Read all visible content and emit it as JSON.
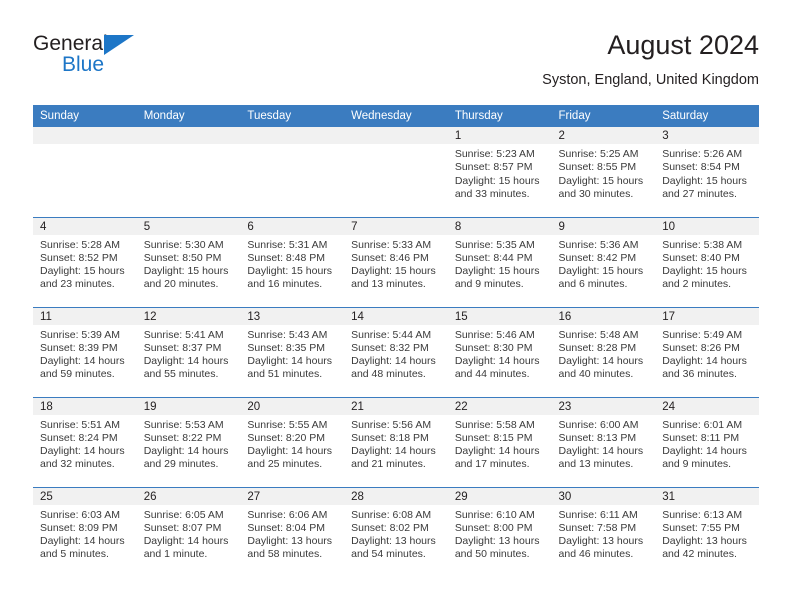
{
  "brand": {
    "name_dark": "General",
    "name_blue": "Blue",
    "accent_color": "#1d76c7"
  },
  "header": {
    "title": "August 2024",
    "location": "Syston, England, United Kingdom",
    "header_bg": "#3b7cc0",
    "daynum_bg": "#f1f1f1"
  },
  "weekday_headers": [
    "Sunday",
    "Monday",
    "Tuesday",
    "Wednesday",
    "Thursday",
    "Friday",
    "Saturday"
  ],
  "labels": {
    "sunrise_prefix": "Sunrise:",
    "sunset_prefix": "Sunset:",
    "daylight_prefix": "Daylight:"
  },
  "weeks": [
    [
      {
        "day": "",
        "sunrise": "",
        "sunset": "",
        "daylight_line1": "",
        "daylight_line2": "",
        "empty": true
      },
      {
        "day": "",
        "sunrise": "",
        "sunset": "",
        "daylight_line1": "",
        "daylight_line2": "",
        "empty": true
      },
      {
        "day": "",
        "sunrise": "",
        "sunset": "",
        "daylight_line1": "",
        "daylight_line2": "",
        "empty": true
      },
      {
        "day": "",
        "sunrise": "",
        "sunset": "",
        "daylight_line1": "",
        "daylight_line2": "",
        "empty": true
      },
      {
        "day": "1",
        "sunrise": "Sunrise: 5:23 AM",
        "sunset": "Sunset: 8:57 PM",
        "daylight_line1": "Daylight: 15 hours",
        "daylight_line2": "and 33 minutes.",
        "empty": false
      },
      {
        "day": "2",
        "sunrise": "Sunrise: 5:25 AM",
        "sunset": "Sunset: 8:55 PM",
        "daylight_line1": "Daylight: 15 hours",
        "daylight_line2": "and 30 minutes.",
        "empty": false
      },
      {
        "day": "3",
        "sunrise": "Sunrise: 5:26 AM",
        "sunset": "Sunset: 8:54 PM",
        "daylight_line1": "Daylight: 15 hours",
        "daylight_line2": "and 27 minutes.",
        "empty": false
      }
    ],
    [
      {
        "day": "4",
        "sunrise": "Sunrise: 5:28 AM",
        "sunset": "Sunset: 8:52 PM",
        "daylight_line1": "Daylight: 15 hours",
        "daylight_line2": "and 23 minutes.",
        "empty": false
      },
      {
        "day": "5",
        "sunrise": "Sunrise: 5:30 AM",
        "sunset": "Sunset: 8:50 PM",
        "daylight_line1": "Daylight: 15 hours",
        "daylight_line2": "and 20 minutes.",
        "empty": false
      },
      {
        "day": "6",
        "sunrise": "Sunrise: 5:31 AM",
        "sunset": "Sunset: 8:48 PM",
        "daylight_line1": "Daylight: 15 hours",
        "daylight_line2": "and 16 minutes.",
        "empty": false
      },
      {
        "day": "7",
        "sunrise": "Sunrise: 5:33 AM",
        "sunset": "Sunset: 8:46 PM",
        "daylight_line1": "Daylight: 15 hours",
        "daylight_line2": "and 13 minutes.",
        "empty": false
      },
      {
        "day": "8",
        "sunrise": "Sunrise: 5:35 AM",
        "sunset": "Sunset: 8:44 PM",
        "daylight_line1": "Daylight: 15 hours",
        "daylight_line2": "and 9 minutes.",
        "empty": false
      },
      {
        "day": "9",
        "sunrise": "Sunrise: 5:36 AM",
        "sunset": "Sunset: 8:42 PM",
        "daylight_line1": "Daylight: 15 hours",
        "daylight_line2": "and 6 minutes.",
        "empty": false
      },
      {
        "day": "10",
        "sunrise": "Sunrise: 5:38 AM",
        "sunset": "Sunset: 8:40 PM",
        "daylight_line1": "Daylight: 15 hours",
        "daylight_line2": "and 2 minutes.",
        "empty": false
      }
    ],
    [
      {
        "day": "11",
        "sunrise": "Sunrise: 5:39 AM",
        "sunset": "Sunset: 8:39 PM",
        "daylight_line1": "Daylight: 14 hours",
        "daylight_line2": "and 59 minutes.",
        "empty": false
      },
      {
        "day": "12",
        "sunrise": "Sunrise: 5:41 AM",
        "sunset": "Sunset: 8:37 PM",
        "daylight_line1": "Daylight: 14 hours",
        "daylight_line2": "and 55 minutes.",
        "empty": false
      },
      {
        "day": "13",
        "sunrise": "Sunrise: 5:43 AM",
        "sunset": "Sunset: 8:35 PM",
        "daylight_line1": "Daylight: 14 hours",
        "daylight_line2": "and 51 minutes.",
        "empty": false
      },
      {
        "day": "14",
        "sunrise": "Sunrise: 5:44 AM",
        "sunset": "Sunset: 8:32 PM",
        "daylight_line1": "Daylight: 14 hours",
        "daylight_line2": "and 48 minutes.",
        "empty": false
      },
      {
        "day": "15",
        "sunrise": "Sunrise: 5:46 AM",
        "sunset": "Sunset: 8:30 PM",
        "daylight_line1": "Daylight: 14 hours",
        "daylight_line2": "and 44 minutes.",
        "empty": false
      },
      {
        "day": "16",
        "sunrise": "Sunrise: 5:48 AM",
        "sunset": "Sunset: 8:28 PM",
        "daylight_line1": "Daylight: 14 hours",
        "daylight_line2": "and 40 minutes.",
        "empty": false
      },
      {
        "day": "17",
        "sunrise": "Sunrise: 5:49 AM",
        "sunset": "Sunset: 8:26 PM",
        "daylight_line1": "Daylight: 14 hours",
        "daylight_line2": "and 36 minutes.",
        "empty": false
      }
    ],
    [
      {
        "day": "18",
        "sunrise": "Sunrise: 5:51 AM",
        "sunset": "Sunset: 8:24 PM",
        "daylight_line1": "Daylight: 14 hours",
        "daylight_line2": "and 32 minutes.",
        "empty": false
      },
      {
        "day": "19",
        "sunrise": "Sunrise: 5:53 AM",
        "sunset": "Sunset: 8:22 PM",
        "daylight_line1": "Daylight: 14 hours",
        "daylight_line2": "and 29 minutes.",
        "empty": false
      },
      {
        "day": "20",
        "sunrise": "Sunrise: 5:55 AM",
        "sunset": "Sunset: 8:20 PM",
        "daylight_line1": "Daylight: 14 hours",
        "daylight_line2": "and 25 minutes.",
        "empty": false
      },
      {
        "day": "21",
        "sunrise": "Sunrise: 5:56 AM",
        "sunset": "Sunset: 8:18 PM",
        "daylight_line1": "Daylight: 14 hours",
        "daylight_line2": "and 21 minutes.",
        "empty": false
      },
      {
        "day": "22",
        "sunrise": "Sunrise: 5:58 AM",
        "sunset": "Sunset: 8:15 PM",
        "daylight_line1": "Daylight: 14 hours",
        "daylight_line2": "and 17 minutes.",
        "empty": false
      },
      {
        "day": "23",
        "sunrise": "Sunrise: 6:00 AM",
        "sunset": "Sunset: 8:13 PM",
        "daylight_line1": "Daylight: 14 hours",
        "daylight_line2": "and 13 minutes.",
        "empty": false
      },
      {
        "day": "24",
        "sunrise": "Sunrise: 6:01 AM",
        "sunset": "Sunset: 8:11 PM",
        "daylight_line1": "Daylight: 14 hours",
        "daylight_line2": "and 9 minutes.",
        "empty": false
      }
    ],
    [
      {
        "day": "25",
        "sunrise": "Sunrise: 6:03 AM",
        "sunset": "Sunset: 8:09 PM",
        "daylight_line1": "Daylight: 14 hours",
        "daylight_line2": "and 5 minutes.",
        "empty": false
      },
      {
        "day": "26",
        "sunrise": "Sunrise: 6:05 AM",
        "sunset": "Sunset: 8:07 PM",
        "daylight_line1": "Daylight: 14 hours",
        "daylight_line2": "and 1 minute.",
        "empty": false
      },
      {
        "day": "27",
        "sunrise": "Sunrise: 6:06 AM",
        "sunset": "Sunset: 8:04 PM",
        "daylight_line1": "Daylight: 13 hours",
        "daylight_line2": "and 58 minutes.",
        "empty": false
      },
      {
        "day": "28",
        "sunrise": "Sunrise: 6:08 AM",
        "sunset": "Sunset: 8:02 PM",
        "daylight_line1": "Daylight: 13 hours",
        "daylight_line2": "and 54 minutes.",
        "empty": false
      },
      {
        "day": "29",
        "sunrise": "Sunrise: 6:10 AM",
        "sunset": "Sunset: 8:00 PM",
        "daylight_line1": "Daylight: 13 hours",
        "daylight_line2": "and 50 minutes.",
        "empty": false
      },
      {
        "day": "30",
        "sunrise": "Sunrise: 6:11 AM",
        "sunset": "Sunset: 7:58 PM",
        "daylight_line1": "Daylight: 13 hours",
        "daylight_line2": "and 46 minutes.",
        "empty": false
      },
      {
        "day": "31",
        "sunrise": "Sunrise: 6:13 AM",
        "sunset": "Sunset: 7:55 PM",
        "daylight_line1": "Daylight: 13 hours",
        "daylight_line2": "and 42 minutes.",
        "empty": false
      }
    ]
  ]
}
